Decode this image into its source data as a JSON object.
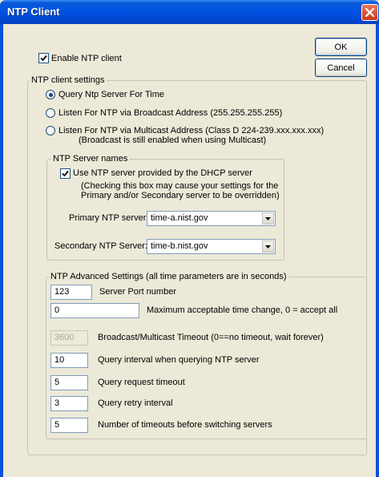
{
  "window": {
    "title": "NTP Client"
  },
  "buttons": {
    "ok": "OK",
    "cancel": "Cancel"
  },
  "enable": {
    "label": "Enable NTP client",
    "checked": true
  },
  "client_settings": {
    "legend": "NTP client settings",
    "options": [
      {
        "label": "Query Ntp Server For Time",
        "selected": true
      },
      {
        "label": "Listen For NTP via Broadcast Address (255.255.255.255)",
        "selected": false
      },
      {
        "label": "Listen For NTP via Multicast Address (Class D 224-239.xxx.xxx.xxx)",
        "sub": "(Broadcast is still enabled when using Multicast)",
        "selected": false
      }
    ]
  },
  "server_names": {
    "legend": "NTP Server names",
    "dhcp_label": "Use NTP server provided by the DHCP server",
    "dhcp_checked": true,
    "dhcp_note1": "(Checking this box may cause your settings for the",
    "dhcp_note2": "Primary and/or Secondary server to be overridden)",
    "primary_label": "Primary NTP server:",
    "primary_value": "time-a.nist.gov",
    "secondary_label": "Secondary NTP Server:",
    "secondary_value": "time-b.nist.gov"
  },
  "advanced": {
    "legend": "NTP Advanced Settings (all time parameters are in seconds)",
    "fields": [
      {
        "value": "123",
        "label": "Server Port number",
        "disabled": false
      },
      {
        "value": "0",
        "label": "Maximum acceptable time change, 0 = accept all",
        "disabled": false
      },
      {
        "value": "3600",
        "label": "Broadcast/Multicast Timeout (0==no timeout, wait forever)",
        "disabled": true
      },
      {
        "value": "10",
        "label": "Query interval when querying NTP server",
        "disabled": false
      },
      {
        "value": "5",
        "label": "Query request timeout",
        "disabled": false
      },
      {
        "value": "3",
        "label": "Query retry interval",
        "disabled": false
      },
      {
        "value": "5",
        "label": "Number of timeouts before switching servers",
        "disabled": false
      }
    ]
  },
  "icons": {
    "close": "close-icon",
    "check": "checkmark-icon",
    "dropdown": "chevron-down-icon"
  }
}
